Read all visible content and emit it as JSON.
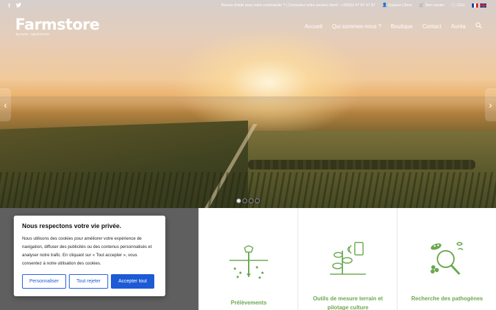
{
  "topbar": {
    "social": [
      {
        "icon": "facebook-icon",
        "glyph": "f"
      },
      {
        "icon": "twitter-icon",
        "glyph": "🐦"
      }
    ],
    "help_text": "Besoin d'aide pour votre commande ? | Contactez notre service client : +33(0)2 47 87 47 87",
    "espace_client": "Espace Client",
    "panier": "Mon panier",
    "cgv": "CGV",
    "languages": [
      "fr",
      "en"
    ]
  },
  "logo": {
    "main": "Farmstore",
    "sub": "by Aurea · Agrosciences"
  },
  "nav": {
    "items": [
      "Accueil",
      "Qui sommes-nous ?",
      "Boutique",
      "Contact",
      "Auréa"
    ]
  },
  "slider": {
    "prev_glyph": "‹",
    "next_glyph": "›",
    "dot_count": 4,
    "active_dot": 0
  },
  "cards": [
    {
      "title": "Prélèvements",
      "icon": "soil-sampling-icon"
    },
    {
      "title": "Outils de mesure terrain et pilotage culture",
      "icon": "plant-sensor-icon"
    },
    {
      "title": "Recherche des pathogènes",
      "icon": "pathogen-search-icon"
    }
  ],
  "cookie": {
    "title": "Nous respectons votre vie privée.",
    "text": "Nous utilisons des cookies pour améliorer votre expérience de navigation, diffuser des publicités ou des contenus personnalisés et analyser notre trafic. En cliquant sur « Tout accepter », vous consentez à notre utilisation des cookies.",
    "customize": "Personnaliser",
    "reject": "Tout rejeter",
    "accept": "Accepter tout"
  },
  "colors": {
    "accent_green": "#6aa84f",
    "cookie_blue": "#1d5bd6"
  }
}
